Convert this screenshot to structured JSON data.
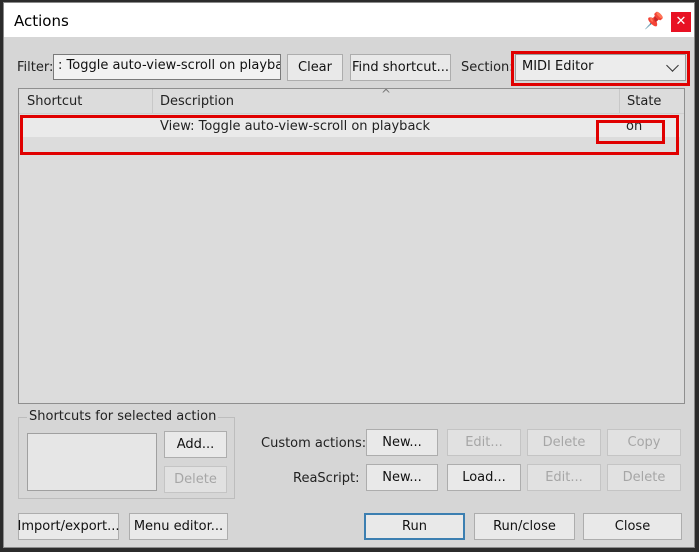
{
  "window": {
    "title": "Actions"
  },
  "filter": {
    "label": "Filter:",
    "value": ": Toggle auto-view-scroll on playback"
  },
  "buttons": {
    "clear": "Clear",
    "find_shortcut": "Find shortcut..."
  },
  "section": {
    "label": "Section:",
    "value": "MIDI Editor"
  },
  "list": {
    "columns": [
      "Shortcut",
      "Description",
      "State"
    ],
    "rows": [
      {
        "shortcut": "",
        "description": "View: Toggle auto-view-scroll on playback",
        "state": "on"
      }
    ]
  },
  "shortcuts_group": {
    "label": "Shortcuts for selected action",
    "add": "Add...",
    "delete": "Delete"
  },
  "custom_actions": {
    "label": "Custom actions:",
    "new": "New...",
    "edit": "Edit...",
    "delete": "Delete",
    "copy": "Copy"
  },
  "reascript": {
    "label": "ReaScript:",
    "new": "New...",
    "load": "Load...",
    "edit": "Edit...",
    "delete": "Delete"
  },
  "footer": {
    "import_export": "Import/export...",
    "menu_editor": "Menu editor...",
    "run": "Run",
    "run_close": "Run/close",
    "close": "Close"
  }
}
